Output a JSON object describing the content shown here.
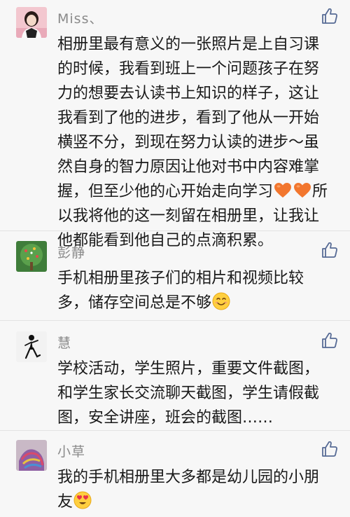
{
  "comments": [
    {
      "name": "Miss、",
      "lines": [
        "相册里最有意义的一张照片是上自习课",
        "的时候，我看到班上一个问题孩子在努",
        "力的想要去认读书上知识的样子，这让",
        "我看到了他的进步，看到了他从一开始",
        "横竖不分，到现在努力认读的进步～虽",
        "然自身的智力原因让他对书中内容难掌",
        "握，但至少他的心开始走向学习",
        "所",
        "以我将他的这一刻留在相册里，让我让",
        "他都能看到他自己的点滴积累。"
      ],
      "emojis": [
        "orange-heart",
        "orange-heart"
      ]
    },
    {
      "name": "彭静",
      "lines": [
        "手机相册里孩子们的相片和视频比较",
        "多，储存空间总是不够"
      ],
      "emojis": [
        "smile"
      ]
    },
    {
      "name": "慧",
      "lines": [
        "学校活动，学生照片，重要文件截图，",
        "和学生家长交流聊天截图，学生请假截",
        "图，安全讲座，班会的截图……"
      ]
    },
    {
      "name": "小草",
      "lines": [
        "我的手机相册里大多都是幼儿园的小朋",
        "友"
      ],
      "emojis": [
        "heart-eyes"
      ]
    }
  ],
  "icons": {
    "like": "thumbs-up-outline-icon"
  },
  "colors": {
    "background": "#f7f7f7",
    "name": "#8a8a8a",
    "text": "#191919",
    "like": "#576b95",
    "divider": "#e3e3e3"
  }
}
